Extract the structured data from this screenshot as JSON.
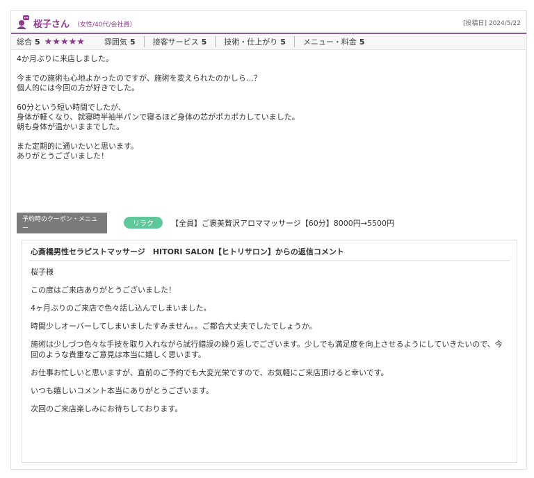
{
  "review": {
    "author": "桜子さん",
    "attributes": "（女性/40代/会社員）",
    "posted": "[投稿日] 2024/5/22"
  },
  "ratings": {
    "overall_label": "総合",
    "overall_value": "5",
    "stars": "★★★★★",
    "items": [
      {
        "label": "雰囲気",
        "value": "5"
      },
      {
        "label": "接客サービス",
        "value": "5"
      },
      {
        "label": "技術・仕上がり",
        "value": "5"
      },
      {
        "label": "メニュー・料金",
        "value": "5"
      }
    ]
  },
  "body": {
    "lines": [
      "4か月ぶりに来店しました。",
      "",
      "今までの施術も心地よかったのですが、施術を変えられたのかしら…？",
      "個人的には今回の方が好きでした。",
      "",
      "60分という短い時間でしたが、",
      "身体が軽くなり、就寝時半袖半パンで寝るほど身体の芯がポカポカしていました。",
      "朝も身体が温かいままでした。",
      "",
      "また定期的に通いたいと思います。",
      "ありがとうございました！"
    ]
  },
  "coupon": {
    "label": "予約時のクーポン・メニュー",
    "tag": "リラク",
    "name": "【全員】ご褒美贅沢アロママッサージ【60分】8000円→5500円"
  },
  "reply": {
    "title": "心斎橋男性セラピストマッサージ　HITORI SALON【ヒトリサロン】からの返信コメント",
    "paragraphs": [
      "桜子様",
      "この度はご来店ありがとうございました！",
      "4ヶ月ぶりのご来店で色々話し込んでしまいました。",
      "時間少しオーバーしてしまいましたすみません。。ご都合大丈夫でしたでしょうか。",
      "施術は少しづつ色々な手技を取り入れながら試行錯誤の繰り返しでございます。少しでも満足度を向上させるようにしていきたいので、今回のような貴重なご意見は本当に嬉しく思います。",
      "お仕事お忙しいと思いますが、直前のご予約でも大変光栄ですので、お気軽にご来店頂けると幸いです。",
      "いつも嬉しいコメント本当にありがとうございます。",
      "次回のご来店楽しみにお待ちしております。"
    ]
  },
  "colors": {
    "accent": "#8c3a8c",
    "tag": "#5fc79a"
  }
}
